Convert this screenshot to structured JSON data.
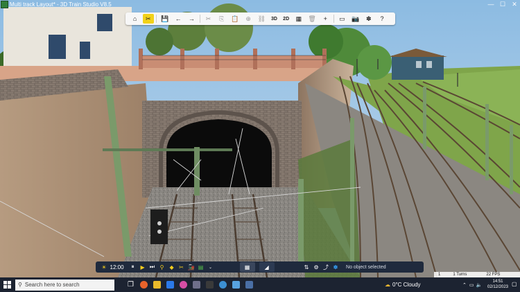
{
  "window": {
    "title": "Multi track Layout* - 3D Train Studio V8.5",
    "controls": [
      "—",
      "☐",
      "✕"
    ]
  },
  "toolbar": {
    "items": [
      {
        "name": "home-icon",
        "glyph": "⌂"
      },
      {
        "name": "tools-icon",
        "glyph": "✂"
      },
      {
        "name": "save-icon",
        "glyph": "💾"
      },
      {
        "name": "undo-icon",
        "glyph": "←"
      },
      {
        "name": "redo-icon",
        "glyph": "→"
      },
      {
        "name": "cut-icon",
        "glyph": "✂"
      },
      {
        "name": "copy-icon",
        "glyph": "⎘"
      },
      {
        "name": "paste-icon",
        "glyph": "📋"
      },
      {
        "name": "layer-icon",
        "glyph": "⊕"
      },
      {
        "name": "link-icon",
        "glyph": "⛓"
      },
      {
        "name": "view-3d-button",
        "glyph": "3D"
      },
      {
        "name": "view-2d-button",
        "glyph": "2D"
      },
      {
        "name": "grid-icon",
        "glyph": "▦"
      },
      {
        "name": "trash-icon",
        "glyph": "🗑"
      },
      {
        "name": "add-icon",
        "glyph": "+"
      },
      {
        "name": "window-icon",
        "glyph": "▭"
      },
      {
        "name": "camera-icon",
        "glyph": "📷"
      },
      {
        "name": "puzzle-icon",
        "glyph": "✽"
      },
      {
        "name": "help-icon",
        "glyph": "?"
      }
    ]
  },
  "bottombar": {
    "time": "12:00",
    "status": "No object selected"
  },
  "status_right": {
    "a": "1",
    "b": "1 Turns",
    "c": "22 FPS"
  },
  "taskbar": {
    "search_placeholder": "Search here to search",
    "weather": "0°C  Cloudy",
    "time": "14:51",
    "date": "02/12/2023"
  }
}
